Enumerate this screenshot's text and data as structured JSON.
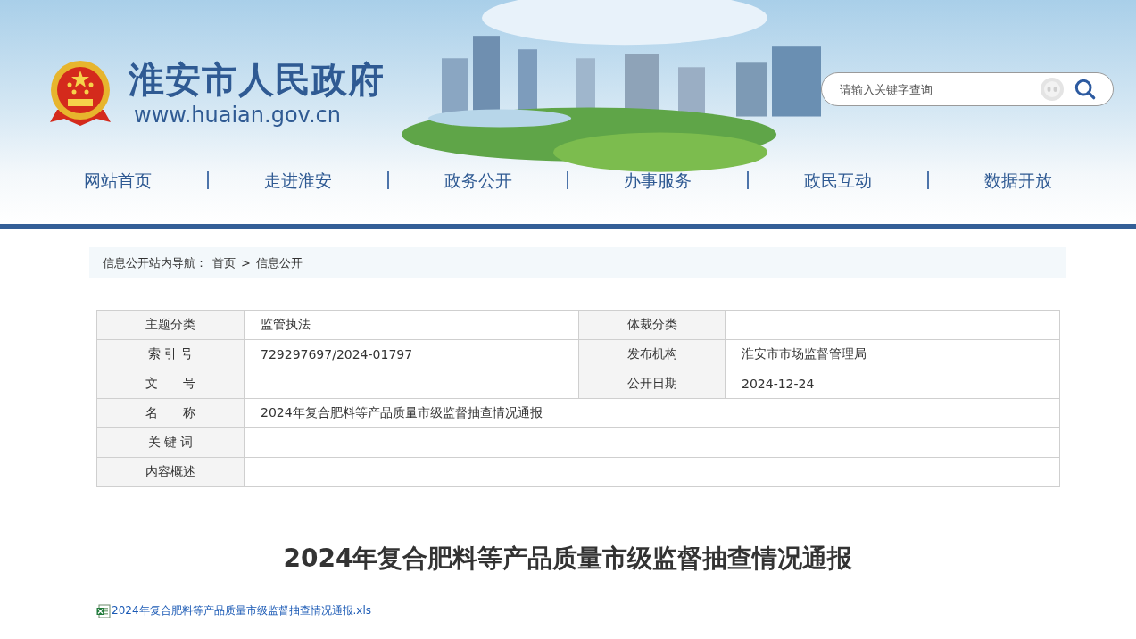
{
  "header": {
    "site_name": "淮安市人民政府",
    "site_url": "www.huaian.gov.cn",
    "search": {
      "placeholder": "请输入关键字查询"
    }
  },
  "nav": [
    {
      "label": "网站首页"
    },
    {
      "label": "走进淮安"
    },
    {
      "label": "政务公开"
    },
    {
      "label": "办事服务"
    },
    {
      "label": "政民互动"
    },
    {
      "label": "数据开放"
    }
  ],
  "breadcrumb": {
    "prefix": "信息公开站内导航：",
    "items": [
      "首页",
      "信息公开"
    ],
    "separator": ">"
  },
  "table": {
    "rows": [
      {
        "cells": [
          {
            "label": "主题分类",
            "value": "监管执法"
          },
          {
            "label": "体裁分类"
          }
        ]
      },
      {
        "cells": [
          {
            "label": "索 引 号",
            "value": "729297697/2024-01797"
          },
          {
            "label": "发布机构",
            "value": "淮安市市场监督管理局"
          }
        ]
      },
      {
        "cells": [
          {
            "label": "文　　号"
          },
          {
            "label": "公开日期",
            "value": "2024-12-24"
          }
        ]
      },
      {
        "cells": [
          {
            "label": "名　　称",
            "value": "2024年复合肥料等产品质量市级监督抽查情况通报"
          }
        ]
      },
      {
        "cells": [
          {
            "label": "关 键 词"
          }
        ]
      },
      {
        "cells": [
          {
            "label": "内容概述"
          }
        ]
      }
    ]
  },
  "article": {
    "title": "2024年复合肥料等产品质量市级监督抽查情况通报",
    "attachments": [
      {
        "kind": "xls",
        "name": "2024年复合肥料等产品质量市级监督抽查情况通报.xls"
      }
    ]
  }
}
